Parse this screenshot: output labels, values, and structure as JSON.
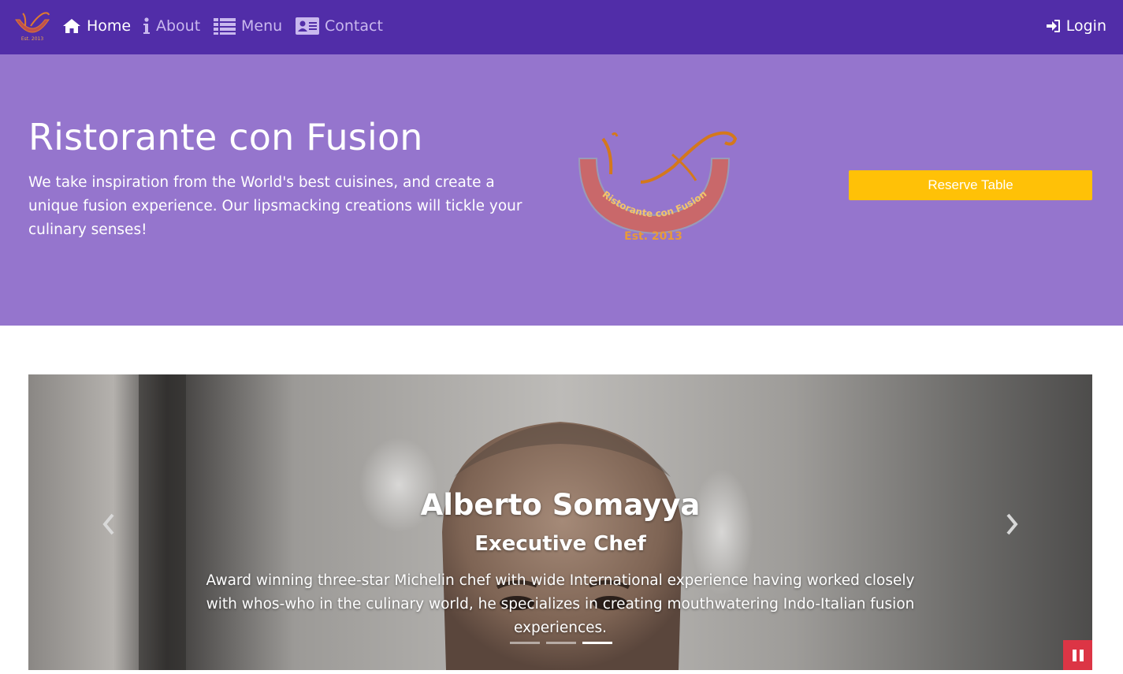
{
  "navbar": {
    "brand": {
      "logo_text": "Est. 2013",
      "icon": "restaurant-logo"
    },
    "items": [
      {
        "label": "Home",
        "icon": "home-icon",
        "active": true
      },
      {
        "label": "About",
        "icon": "info-icon",
        "active": false
      },
      {
        "label": "Menu",
        "icon": "list-icon",
        "active": false
      },
      {
        "label": "Contact",
        "icon": "address-card-icon",
        "active": false
      }
    ],
    "login": {
      "label": "Login",
      "icon": "sign-in-icon"
    }
  },
  "jumbotron": {
    "title": "Ristorante con Fusion",
    "description": "We take inspiration from the World's best cuisines, and create a unique fusion experience. Our lipsmacking creations will tickle your culinary senses!",
    "logo": {
      "arc_text": "Ristorante con Fusion",
      "est_text": "Est. 2013"
    },
    "reserve_button": "Reserve Table"
  },
  "carousel": {
    "slide": {
      "name": "Alberto Somayya",
      "role": "Executive Chef",
      "description": "Award winning three-star Michelin chef with wide International experience having worked closely with whos-who in the culinary world, he specializes in creating mouthwatering Indo-Italian fusion experiences."
    },
    "indicator_count": 3,
    "active_indicator": 3,
    "controls": {
      "prev_icon": "chevron-left-icon",
      "next_icon": "chevron-right-icon",
      "pause_icon": "pause-icon"
    }
  },
  "colors": {
    "navbar": "#512da8",
    "jumbotron": "#9575cd",
    "reserve_button": "#ffc107",
    "pause_button": "#dc3545",
    "nav_inactive": "#c9b8ee"
  }
}
